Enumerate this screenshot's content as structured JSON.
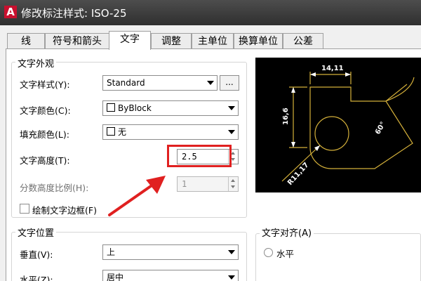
{
  "window": {
    "title": "修改标注样式: ISO-25",
    "app_icon_letter": "A"
  },
  "tabs": [
    "线",
    "符号和箭头",
    "文字",
    "调整",
    "主单位",
    "换算单位",
    "公差"
  ],
  "active_tab": "文字",
  "appearance": {
    "title": "文字外观",
    "text_style": {
      "label": "文字样式(Y):",
      "value": "Standard",
      "dots": "..."
    },
    "text_color": {
      "label": "文字颜色(C):",
      "value": "ByBlock"
    },
    "fill_color": {
      "label": "填充颜色(L):",
      "value": "无"
    },
    "text_height": {
      "label": "文字高度(T):",
      "value": "2.5"
    },
    "fraction_scale": {
      "label": "分数高度比例(H):",
      "value": "1"
    },
    "draw_frame": {
      "label": "绘制文字边框(F)",
      "checked": false
    }
  },
  "placement": {
    "title": "文字位置",
    "vertical": {
      "label": "垂直(V):",
      "value": "上"
    },
    "horizontal": {
      "label": "水平(Z):",
      "value": "居中"
    }
  },
  "alignment": {
    "title": "文字对齐(A)",
    "horizontal_option": "水平"
  },
  "preview": {
    "dims": [
      "14,11",
      "16,6",
      "60°",
      "R11,17"
    ]
  },
  "colors": {
    "preview_line": "#d4b03a",
    "preview_bg": "#000000",
    "highlight": "#e02020"
  }
}
